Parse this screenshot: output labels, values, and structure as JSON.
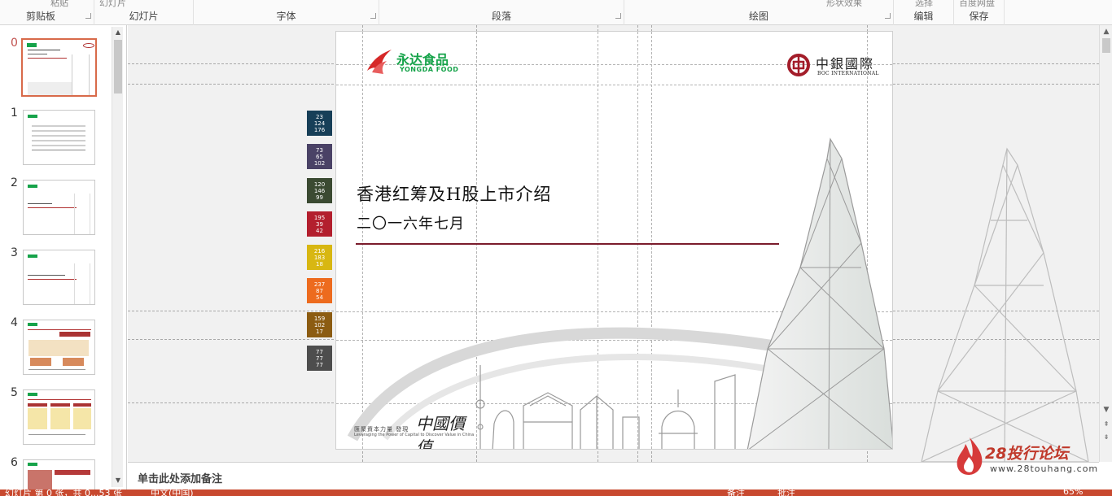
{
  "ribbon": {
    "groups": [
      {
        "label": "剪贴板"
      },
      {
        "label": "幻灯片"
      },
      {
        "label": "字体"
      },
      {
        "label": "段落"
      },
      {
        "label": "绘图"
      },
      {
        "label": "编辑"
      },
      {
        "label": "保存"
      }
    ],
    "ghost_top": {
      "a": "粘贴",
      "b": "幻灯片",
      "c": "形状效果",
      "d": "选择",
      "e": "百度网盘"
    }
  },
  "thumbnails": {
    "items": [
      {
        "number": "0",
        "active": true
      },
      {
        "number": "1",
        "active": false
      },
      {
        "number": "2",
        "active": false
      },
      {
        "number": "3",
        "active": false
      },
      {
        "number": "4",
        "active": false
      },
      {
        "number": "5",
        "active": false
      },
      {
        "number": "6",
        "active": false
      }
    ]
  },
  "slide": {
    "title": "香港红筹及H股上市介绍",
    "subtitle": "二〇一六年七月",
    "logo_left_cn": "永达食品",
    "logo_left_en": "YONGDA FOOD",
    "logo_right_cn": "中銀國際",
    "logo_right_en": "BOC INTERNATIONAL",
    "slogan_cn": "匯聚資本力量  發現",
    "slogan_big": "中國價值",
    "slogan_en": "Leveraging the Power of Capital to     Discover Value in China"
  },
  "swatches": [
    {
      "line1": "23",
      "line2": "124",
      "line3": "176",
      "color": "#173f58"
    },
    {
      "line1": "73",
      "line2": "65",
      "line3": "102",
      "color": "#4a4266"
    },
    {
      "line1": "120",
      "line2": "146",
      "line3": "99",
      "color": "#3b4a32"
    },
    {
      "line1": "195",
      "line2": "39",
      "line3": "42",
      "color": "#b31f2e"
    },
    {
      "line1": "216",
      "line2": "183",
      "line3": "18",
      "color": "#d8b712"
    },
    {
      "line1": "237",
      "line2": "87",
      "line3": "54",
      "color": "#ed6b1e"
    },
    {
      "line1": "159",
      "line2": "102",
      "line3": "17",
      "color": "#8c5c12"
    },
    {
      "line1": "77",
      "line2": "77",
      "line3": "77",
      "color": "#4d4d4d"
    }
  ],
  "notes": {
    "placeholder": "单击此处添加备注"
  },
  "status": {
    "slide_info": "幻灯片 第 0 张，共 0...53 张",
    "language": "中文(中国)",
    "notes_btn": "备注",
    "comments_btn": "批注",
    "zoom": "65%"
  },
  "watermark": {
    "big": "28投行论坛",
    "url": "www.28touhang.com"
  }
}
